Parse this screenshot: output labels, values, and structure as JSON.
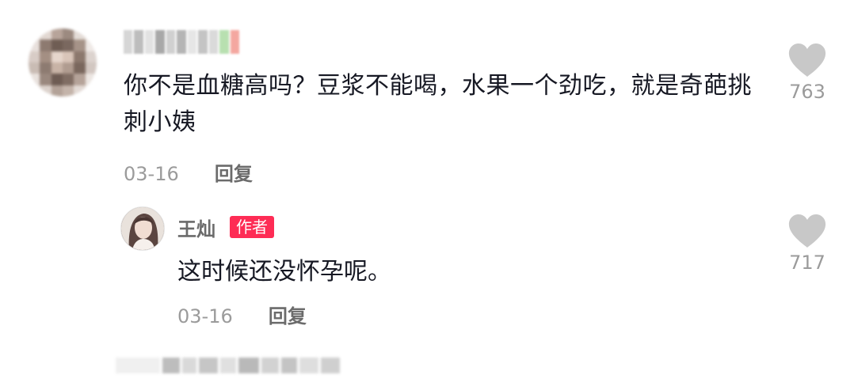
{
  "comment": {
    "text": "你不是血糖高吗？豆浆不能喝，水果一个劲吃，就是奇葩挑刺小姨",
    "date": "03-16",
    "reply_label": "回复",
    "likes": "763"
  },
  "reply": {
    "author": "王灿",
    "badge": "作者",
    "text": "这时候还没怀孕呢。",
    "date": "03-16",
    "reply_label": "回复",
    "likes": "717"
  },
  "colors": {
    "badge": "#fe2c55",
    "heart": "#c8c8c8",
    "meta": "#9b9b9b"
  },
  "icons": {
    "like": "heart-icon"
  }
}
